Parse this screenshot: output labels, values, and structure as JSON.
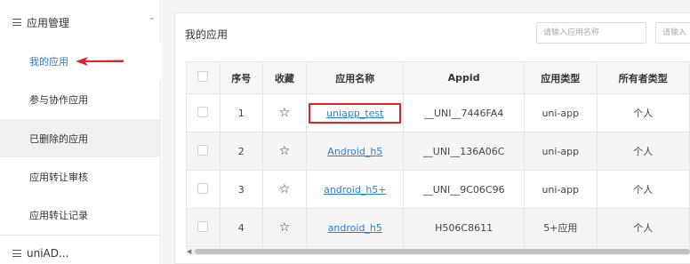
{
  "sidebar": {
    "group_app_mgmt": {
      "label": "应用管理",
      "icon": "menu-list-icon",
      "chevron": "chevron-up-icon"
    },
    "items": [
      {
        "label": "我的应用"
      },
      {
        "label": "参与协作应用"
      },
      {
        "label": "已删除的应用"
      },
      {
        "label": "应用转让审核"
      },
      {
        "label": "应用转让记录"
      }
    ],
    "group_uniad": {
      "label": "uniAD..."
    }
  },
  "main": {
    "title": "我的应用",
    "search_app_name": {
      "placeholder": "请输入应用名称"
    },
    "search_second": {
      "placeholder": "请输入"
    }
  },
  "table": {
    "headers": [
      "序号",
      "收藏",
      "应用名称",
      "Appid",
      "应用类型",
      "所有者类型"
    ],
    "rows": [
      {
        "index": "1",
        "name": "uniapp_test",
        "appid": "__UNI__7446FA4",
        "type": "uni-app",
        "owner": "个人"
      },
      {
        "index": "2",
        "name": "Android_h5",
        "appid": "__UNI__136A06C",
        "type": "uni-app",
        "owner": "个人"
      },
      {
        "index": "3",
        "name": "android_h5+",
        "appid": "__UNI__9C06C96",
        "type": "uni-app",
        "owner": "个人"
      },
      {
        "index": "4",
        "name": "android_h5",
        "appid": "H506C8611",
        "type": "5+应用",
        "owner": "个人"
      }
    ]
  },
  "colors": {
    "accent": "#2b7cd8",
    "annotation_red": "#d9262e"
  }
}
